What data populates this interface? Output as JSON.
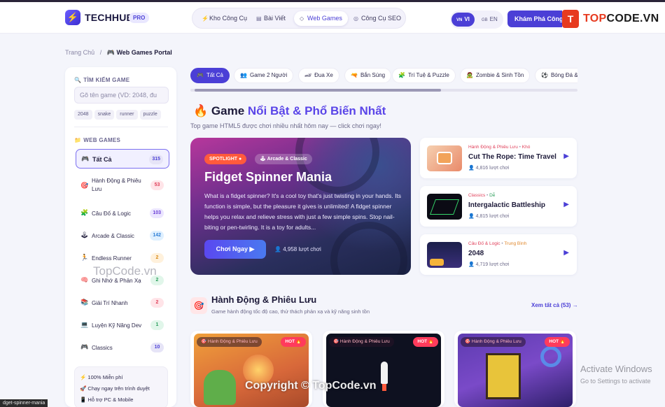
{
  "header": {
    "brand": "TECHHUB",
    "brand_badge": "PRO",
    "nav": [
      {
        "icon": "⚡",
        "label": "Kho Công Cụ"
      },
      {
        "icon": "▤",
        "label": "Bài Viết"
      },
      {
        "icon": "◇",
        "label": "Web Games"
      },
      {
        "icon": "◎",
        "label": "Công Cụ SEO"
      }
    ],
    "lang": [
      {
        "flag": "VN",
        "label": "VI"
      },
      {
        "flag": "GB",
        "label": "EN"
      }
    ],
    "cta": "Khám Phá Công Cụ",
    "watermark_brand": {
      "mark": "T",
      "prefix": "TOP",
      "suffix": "CODE.VN"
    }
  },
  "breadcrumb": {
    "home": "Trang Chủ",
    "sep": "/",
    "current": "🎮 Web Games Portal"
  },
  "sidebar": {
    "search_title": "TÌM KIẾM GAME",
    "search_placeholder": "Gõ tên game (VD: 2048, đu",
    "tags": [
      "2048",
      "snake",
      "runner",
      "puzzle"
    ],
    "games_title": "WEB GAMES",
    "categories": [
      {
        "icon": "🎮",
        "label": "Tất Cả",
        "count": "315"
      },
      {
        "icon": "🎯",
        "label": "Hành Động & Phiêu Lưu",
        "count": "53"
      },
      {
        "icon": "🧩",
        "label": "Câu Đố & Logic",
        "count": "103"
      },
      {
        "icon": "🕹",
        "label": "Arcade & Classic",
        "count": "142"
      },
      {
        "icon": "🏃",
        "label": "Endless Runner",
        "count": "2"
      },
      {
        "icon": "🧠",
        "label": "Ghi Nhớ & Phản Xạ",
        "count": "2"
      },
      {
        "icon": "📚",
        "label": "Giải Trí Nhanh",
        "count": "2"
      },
      {
        "icon": "💻",
        "label": "Luyện Kỹ Năng Dev",
        "count": "1"
      },
      {
        "icon": "🎮",
        "label": "Classics",
        "count": "10"
      }
    ],
    "features": [
      "⚡ 100% Miễn phí",
      "🚀 Chạy ngay trên trình duyệt",
      "📱 Hỗ trợ PC & Mobile"
    ]
  },
  "tabs": [
    {
      "icon": "🎮",
      "label": "Tất Cả"
    },
    {
      "icon": "👥",
      "label": "Game 2 Người"
    },
    {
      "icon": "🏎",
      "label": "Đua Xe"
    },
    {
      "icon": "🔫",
      "label": "Bắn Súng"
    },
    {
      "icon": "🧩",
      "label": "Trí Tuệ & Puzzle"
    },
    {
      "icon": "🧟",
      "label": "Zombie & Sinh Tồn"
    },
    {
      "icon": "⚽",
      "label": "Bóng Đá & Thể Thao"
    }
  ],
  "featured": {
    "title_icon": "🔥",
    "title_a": "Game ",
    "title_b": "Nổi Bật & Phổ Biến Nhất",
    "subtitle": "Top game HTML5 được chơi nhiều nhất hôm nay — click chơi ngay!",
    "hero": {
      "badge_spotlight": "SPOTLIGHT",
      "badge_category": "Arcade & Classic",
      "title": "Fidget Spinner Mania",
      "description": "What is a fidget spinner? It's a cool toy that's just twisting in your hands. Its function is simple, but the pleasure it gives is unlimited! A fidget spinner helps you relax and relieve stress with just a few simple spins. Stop nail-biting or pen-twirling. It is a toy for adults...",
      "play_label": "Chơi Ngay ▶",
      "plays": "4,958 lượt chơi"
    },
    "side_games": [
      {
        "category": "Hành Động & Phiêu Lưu",
        "difficulty": "Khó",
        "title": "Cut The Rope: Time Travel",
        "plays": "4,816 lượt chơi"
      },
      {
        "category": "Classics",
        "difficulty": "Dễ",
        "title": "Intergalactic Battleship",
        "plays": "4,815 lượt chơi"
      },
      {
        "category": "Câu Đố & Logic",
        "difficulty": "Trung Bình",
        "title": "2048",
        "plays": "4,719 lượt chơi"
      }
    ]
  },
  "action_section": {
    "icon": "🎯",
    "title": "Hành Động & Phiêu Lưu",
    "subtitle": "Game hành động tốc độ cao, thử thách phản xạ và kỹ năng sinh tồn",
    "see_all": "Xem tất cả (53) →",
    "cards": [
      {
        "category": "🎯 Hành Động & Phiêu Lưu",
        "badge": "HOT 🔥"
      },
      {
        "category": "🎯 Hành Động & Phiêu Lưu",
        "badge": "HOT 🔥"
      },
      {
        "category": "🎯 Hành Động & Phiêu Lưu",
        "badge": "HOT 🔥"
      }
    ]
  },
  "overlays": {
    "status_url": "dget-spinner-mania",
    "watermark": "TopCode.vn",
    "copyright": "Copyright © TopCode.vn",
    "activate_title": "Activate Windows",
    "activate_sub": "Go to Settings to activate"
  }
}
